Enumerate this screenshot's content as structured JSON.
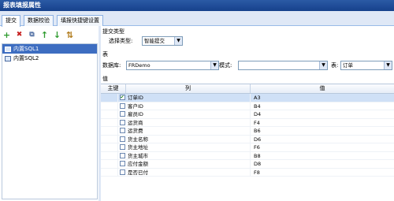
{
  "window": {
    "title": "报表填报属性"
  },
  "tabs": [
    {
      "label": "提交"
    },
    {
      "label": "数据校验"
    },
    {
      "label": "填报快捷键设置"
    }
  ],
  "toolbar": {
    "add": "+",
    "delete": "✖",
    "copy": "⧉",
    "up": "↑",
    "down": "↓",
    "sort": "⇅"
  },
  "tree": {
    "items": [
      {
        "label": "内置SQL1",
        "selected": true
      },
      {
        "label": "内置SQL2",
        "selected": false
      }
    ]
  },
  "submit": {
    "section_label": "提交类型",
    "type_label": "选择类型:",
    "type_value": "智能提交"
  },
  "table_section": {
    "section_label": "表",
    "db_label": "数据库:",
    "db_value": "FRDemo",
    "schema_label": "模式:",
    "schema_value": "",
    "table_label": "表:",
    "table_value": "订单"
  },
  "values_section": {
    "section_label": "值",
    "headers": {
      "key": "主键",
      "column": "列",
      "value": "值"
    },
    "rows": [
      {
        "checked": true,
        "column": "订单ID",
        "value": "A3"
      },
      {
        "checked": false,
        "column": "客户ID",
        "value": "B4"
      },
      {
        "checked": false,
        "column": "雇员ID",
        "value": "D4"
      },
      {
        "checked": false,
        "column": "运货商",
        "value": "F4"
      },
      {
        "checked": false,
        "column": "运货费",
        "value": "B6"
      },
      {
        "checked": false,
        "column": "货主名称",
        "value": "D6"
      },
      {
        "checked": false,
        "column": "货主地址",
        "value": "F6"
      },
      {
        "checked": false,
        "column": "货主城市",
        "value": "B8"
      },
      {
        "checked": false,
        "column": "应付金额",
        "value": "D8"
      },
      {
        "checked": false,
        "column": "是否已付",
        "value": "F8"
      }
    ]
  },
  "colors": {
    "accent": "#3d6dc1",
    "panel_bg": "#dfe8f6",
    "border": "#99bbe8"
  }
}
